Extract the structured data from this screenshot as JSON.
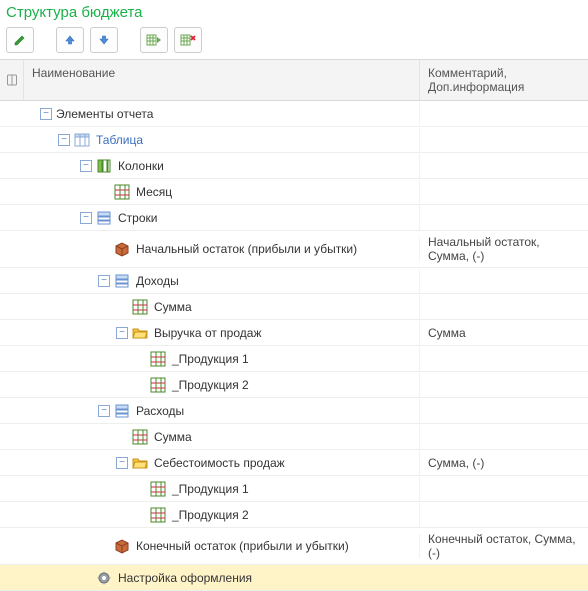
{
  "title": "Структура бюджета",
  "columns": {
    "name": "Наименование",
    "comment": "Комментарий, Доп.информация"
  },
  "toolbar": {
    "edit": "edit",
    "up": "up",
    "down": "down",
    "add_col": "add-column",
    "del_col": "delete-column"
  },
  "tree": [
    {
      "id": "elements",
      "indent": 40,
      "toggle": "-",
      "icon": "none",
      "label": "Элементы отчета",
      "comment": "",
      "blue": false
    },
    {
      "id": "table",
      "indent": 58,
      "toggle": "-",
      "icon": "table",
      "label": "Таблица",
      "comment": "",
      "blue": true
    },
    {
      "id": "columns",
      "indent": 80,
      "toggle": "-",
      "icon": "cols",
      "label": "Колонки",
      "comment": "",
      "blue": false
    },
    {
      "id": "month",
      "indent": 98,
      "toggle": "",
      "icon": "grid",
      "label": "Месяц",
      "comment": "",
      "blue": false
    },
    {
      "id": "rows",
      "indent": 80,
      "toggle": "-",
      "icon": "rows",
      "label": "Строки",
      "comment": "",
      "blue": false
    },
    {
      "id": "begbal",
      "indent": 98,
      "toggle": "",
      "icon": "brick",
      "label": "Начальный остаток (прибыли и убытки)",
      "comment": "Начальный остаток, Сумма, (-)",
      "blue": false
    },
    {
      "id": "income",
      "indent": 98,
      "toggle": "-",
      "icon": "rows",
      "label": "Доходы",
      "comment": "",
      "blue": false
    },
    {
      "id": "sum1",
      "indent": 116,
      "toggle": "",
      "icon": "grid",
      "label": "Сумма",
      "comment": "",
      "blue": false
    },
    {
      "id": "sales",
      "indent": 116,
      "toggle": "-",
      "icon": "folder",
      "label": "Выручка от продаж",
      "comment": "Сумма",
      "blue": false
    },
    {
      "id": "prod1a",
      "indent": 134,
      "toggle": "",
      "icon": "grid",
      "label": "_Продукция 1",
      "comment": "",
      "blue": false
    },
    {
      "id": "prod2a",
      "indent": 134,
      "toggle": "",
      "icon": "grid",
      "label": "_Продукция 2",
      "comment": "",
      "blue": false
    },
    {
      "id": "expenses",
      "indent": 98,
      "toggle": "-",
      "icon": "rows",
      "label": "Расходы",
      "comment": "",
      "blue": false
    },
    {
      "id": "sum2",
      "indent": 116,
      "toggle": "",
      "icon": "grid",
      "label": "Сумма",
      "comment": "",
      "blue": false
    },
    {
      "id": "cost",
      "indent": 116,
      "toggle": "-",
      "icon": "folder",
      "label": "Себестоимость продаж",
      "comment": "Сумма, (-)",
      "blue": false
    },
    {
      "id": "prod1b",
      "indent": 134,
      "toggle": "",
      "icon": "grid",
      "label": "_Продукция 1",
      "comment": "",
      "blue": false
    },
    {
      "id": "prod2b",
      "indent": 134,
      "toggle": "",
      "icon": "grid",
      "label": "_Продукция 2",
      "comment": "",
      "blue": false
    },
    {
      "id": "endbal",
      "indent": 98,
      "toggle": "",
      "icon": "brick",
      "label": "Конечный остаток (прибыли и убытки)",
      "comment": "Конечный остаток, Сумма, (-)",
      "blue": false
    },
    {
      "id": "format",
      "indent": 80,
      "toggle": "",
      "icon": "gear",
      "label": "Настройка оформления",
      "comment": "",
      "blue": false,
      "selected": true
    }
  ]
}
